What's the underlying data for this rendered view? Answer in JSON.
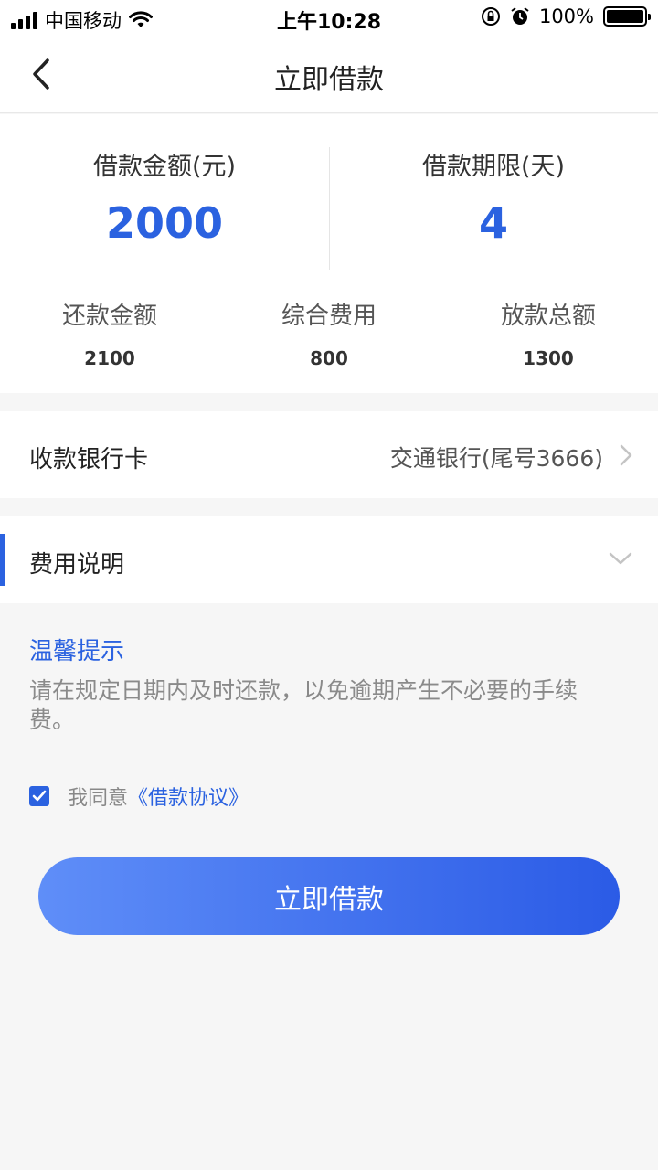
{
  "status_bar": {
    "carrier": "中国移动",
    "time": "上午10:28",
    "battery": "100%"
  },
  "nav": {
    "title": "立即借款"
  },
  "loan": {
    "amount_label": "借款金额(元)",
    "amount_value": "2000",
    "term_label": "借款期限(天)",
    "term_value": "4"
  },
  "details": [
    {
      "label": "还款金额",
      "value": "2100"
    },
    {
      "label": "综合费用",
      "value": "800"
    },
    {
      "label": "放款总额",
      "value": "1300"
    }
  ],
  "bank": {
    "label": "收款银行卡",
    "value": "交通银行(尾号3666)"
  },
  "fee": {
    "label": "费用说明"
  },
  "tips": {
    "title": "温馨提示",
    "text": "请在规定日期内及时还款，以免逾期产生不必要的手续 费。"
  },
  "agreement": {
    "text": "我同意",
    "link": "《借款协议》",
    "checked": true
  },
  "submit": {
    "label": "立即借款"
  },
  "colors": {
    "accent": "#2b62e0"
  }
}
